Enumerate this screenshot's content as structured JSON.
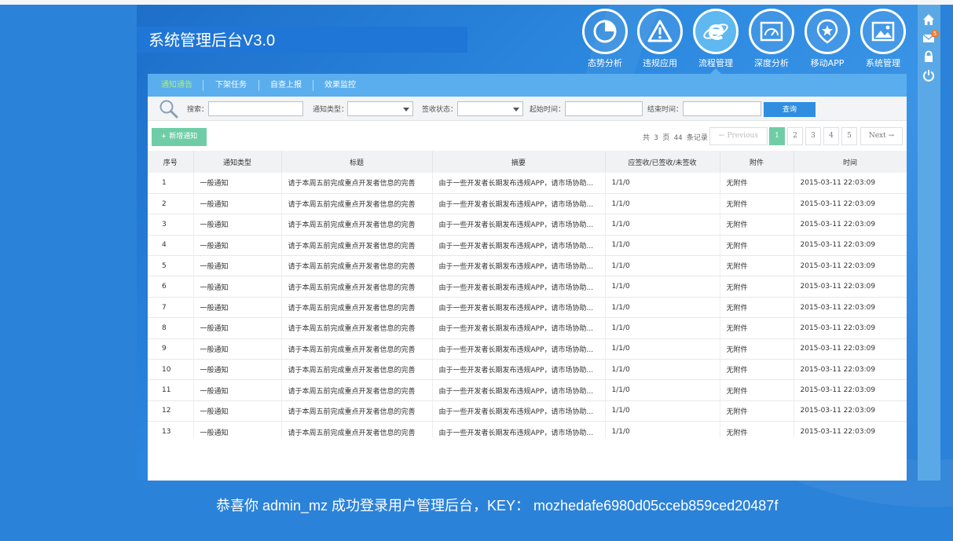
{
  "app": {
    "title": "系统管理后台V3.0"
  },
  "nav": [
    {
      "label": "态势分析",
      "icon": "pie-chart-icon"
    },
    {
      "label": "违规应用",
      "icon": "warning-icon"
    },
    {
      "label": "流程管理",
      "icon": "browser-e-icon",
      "active": true
    },
    {
      "label": "深度分析",
      "icon": "gauge-icon"
    },
    {
      "label": "移动APP",
      "icon": "star-badge-icon"
    },
    {
      "label": "系统管理",
      "icon": "image-icon"
    }
  ],
  "side": {
    "mail_badge": "5",
    "icons": [
      "home-icon",
      "mail-icon",
      "lock-icon",
      "power-icon"
    ]
  },
  "tabs": [
    {
      "label": "通知通告",
      "active": true
    },
    {
      "label": "下架任务"
    },
    {
      "label": "自查上报"
    },
    {
      "label": "效果监控"
    }
  ],
  "filter": {
    "search_label": "搜索：",
    "search_value": "",
    "type_label": "通知类型：",
    "type_value": "",
    "status_label": "签收状态：",
    "status_value": "",
    "start_label": "起始时间：",
    "start_value": "",
    "end_label": "结束时间：",
    "end_value": "",
    "query_label": "查询"
  },
  "toolbar": {
    "add_label": "+  新增通知",
    "records": "共 3 页 44 条记录"
  },
  "pagination": {
    "prev": "← Previous",
    "pages": [
      "1",
      "2",
      "3",
      "4",
      "5"
    ],
    "current": "1",
    "next": "Next →"
  },
  "table": {
    "headers": [
      "序号",
      "通知类型",
      "标题",
      "摘要",
      "应签收/已签收/未签收",
      "附件",
      "时间"
    ],
    "rows": [
      [
        "1",
        "一般通知",
        "请于本周五前完成重点开发者信息的完善",
        "由于一些开发者长期发布违规APP，请市场协助...",
        "1/1/0",
        "无附件",
        "2015-03-11 22:03:09"
      ],
      [
        "2",
        "一般通知",
        "请于本周五前完成重点开发者信息的完善",
        "由于一些开发者长期发布违规APP，请市场协助...",
        "1/1/0",
        "无附件",
        "2015-03-11 22:03:09"
      ],
      [
        "3",
        "一般通知",
        "请于本周五前完成重点开发者信息的完善",
        "由于一些开发者长期发布违规APP，请市场协助...",
        "1/1/0",
        "无附件",
        "2015-03-11 22:03:09"
      ],
      [
        "4",
        "一般通知",
        "请于本周五前完成重点开发者信息的完善",
        "由于一些开发者长期发布违规APP，请市场协助...",
        "1/1/0",
        "无附件",
        "2015-03-11 22:03:09"
      ],
      [
        "5",
        "一般通知",
        "请于本周五前完成重点开发者信息的完善",
        "由于一些开发者长期发布违规APP，请市场协助...",
        "1/1/0",
        "无附件",
        "2015-03-11 22:03:09"
      ],
      [
        "6",
        "一般通知",
        "请于本周五前完成重点开发者信息的完善",
        "由于一些开发者长期发布违规APP，请市场协助...",
        "1/1/0",
        "无附件",
        "2015-03-11 22:03:09"
      ],
      [
        "7",
        "一般通知",
        "请于本周五前完成重点开发者信息的完善",
        "由于一些开发者长期发布违规APP，请市场协助...",
        "1/1/0",
        "无附件",
        "2015-03-11 22:03:09"
      ],
      [
        "8",
        "一般通知",
        "请于本周五前完成重点开发者信息的完善",
        "由于一些开发者长期发布违规APP，请市场协助...",
        "1/1/0",
        "无附件",
        "2015-03-11 22:03:09"
      ],
      [
        "9",
        "一般通知",
        "请于本周五前完成重点开发者信息的完善",
        "由于一些开发者长期发布违规APP，请市场协助...",
        "1/1/0",
        "无附件",
        "2015-03-11 22:03:09"
      ],
      [
        "10",
        "一般通知",
        "请于本周五前完成重点开发者信息的完善",
        "由于一些开发者长期发布违规APP，请市场协助...",
        "1/1/0",
        "无附件",
        "2015-03-11 22:03:09"
      ],
      [
        "11",
        "一般通知",
        "请于本周五前完成重点开发者信息的完善",
        "由于一些开发者长期发布违规APP，请市场协助...",
        "1/1/0",
        "无附件",
        "2015-03-11 22:03:09"
      ],
      [
        "12",
        "一般通知",
        "请于本周五前完成重点开发者信息的完善",
        "由于一些开发者长期发布违规APP，请市场协助...",
        "1/1/0",
        "无附件",
        "2015-03-11 22:03:09"
      ],
      [
        "13",
        "一般通知",
        "请于本周五前完成重点开发者信息的完善",
        "由于一些开发者长期发布违规APP，请市场协助...",
        "1/1/0",
        "无附件",
        "2015-03-11 22:03:09"
      ]
    ]
  },
  "footer": {
    "message": "恭喜你 admin_mz 成功登录用户管理后台，KEY： mozhedafe6980d05cceb859ced20487f"
  },
  "colors": {
    "background": "#2b82d9",
    "tab_bar": "#5aaeee",
    "active_tab": "#a5f07a",
    "add_button": "#6fcda6",
    "query_button": "#2f8ee0"
  }
}
